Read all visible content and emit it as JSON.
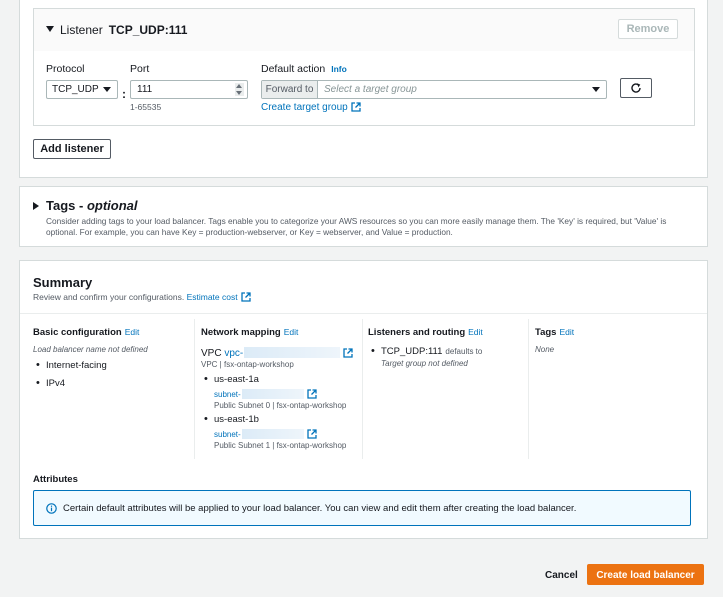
{
  "listener": {
    "title_prefix": "Listener",
    "title_value": "TCP_UDP:111",
    "remove_label": "Remove",
    "protocol": {
      "label": "Protocol",
      "value": "TCP_UDP"
    },
    "port": {
      "label": "Port",
      "value": "111",
      "hint": "1-65535"
    },
    "default_action": {
      "label": "Default action",
      "info_label": "Info",
      "forward_label": "Forward to",
      "target_placeholder": "Select a target group",
      "create_link": "Create target group"
    },
    "refresh_icon": "refresh-icon"
  },
  "add_listener_label": "Add listener",
  "tags": {
    "title": "Tags -",
    "title_optional": "optional",
    "description": "Consider adding tags to your load balancer. Tags enable you to categorize your AWS resources so you can more easily manage them. The 'Key' is required, but 'Value' is optional. For example, you can have Key = production-webserver, or Key = webserver, and Value = production."
  },
  "summary": {
    "title": "Summary",
    "description": "Review and confirm your configurations.",
    "estimate_link": "Estimate cost",
    "edit_label": "Edit",
    "basic": {
      "title": "Basic configuration",
      "name_note": "Load balancer name not defined",
      "items": [
        "Internet-facing",
        "IPv4"
      ]
    },
    "network": {
      "title": "Network mapping",
      "vpc_label": "VPC",
      "vpc_link": "vpc-",
      "vpc_desc": "VPC | fsx-ontap-workshop",
      "zones": [
        {
          "name": "us-east-1a",
          "subnet_link": "subnet-",
          "subnet_desc": "Public Subnet 0 | fsx-ontap-workshop"
        },
        {
          "name": "us-east-1b",
          "subnet_link": "subnet-",
          "subnet_desc": "Public Subnet 1 | fsx-ontap-workshop"
        }
      ]
    },
    "routing": {
      "title": "Listeners and routing",
      "listener": "TCP_UDP:111",
      "defaults_to": "defaults to",
      "target_note": "Target group not defined"
    },
    "tags": {
      "title": "Tags",
      "value": "None"
    },
    "attributes": {
      "title": "Attributes",
      "info": "Certain default attributes will be applied to your load balancer. You can view and edit them after creating the load balancer."
    }
  },
  "footer": {
    "cancel_label": "Cancel",
    "create_label": "Create load balancer"
  },
  "colors": {
    "link": "#0073bb",
    "primary_button": "#ec7211",
    "info_background": "#f1faff"
  }
}
